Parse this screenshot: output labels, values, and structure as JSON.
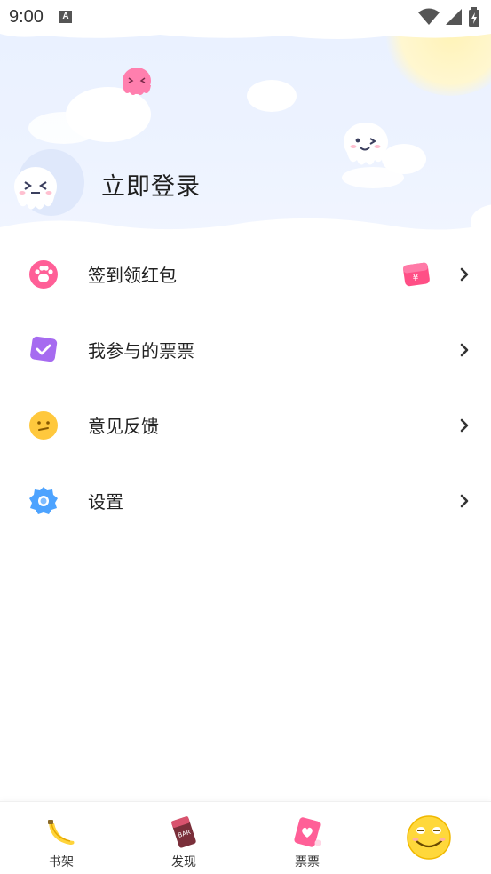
{
  "status_bar": {
    "time": "9:00",
    "notification_glyph": "A",
    "icons": [
      "wifi-icon",
      "signal-icon",
      "battery-icon"
    ]
  },
  "header": {
    "login_label": "立即登录"
  },
  "menu": {
    "items": [
      {
        "label": "签到领红包",
        "icon": "paw-icon",
        "extra_icon": "red-packet-icon"
      },
      {
        "label": "我参与的票票",
        "icon": "ticket-check-icon"
      },
      {
        "label": "意见反馈",
        "icon": "face-icon"
      },
      {
        "label": "设置",
        "icon": "gear-icon"
      }
    ]
  },
  "redpack": {
    "symbol": "¥"
  },
  "bottom_nav": {
    "items": [
      {
        "label": "书架",
        "icon": "banana-icon"
      },
      {
        "label": "发现",
        "icon": "chocolate-icon"
      },
      {
        "label": "票票",
        "icon": "heart-ticket-icon"
      },
      {
        "label": "",
        "icon": "smiley-avatar-icon"
      }
    ],
    "discover_badge": "BAR"
  },
  "colors": {
    "header_bg": "#eaf1ff",
    "pink": "#ff5f97",
    "purple": "#a66bf0",
    "yellow": "#ffc83d",
    "blue": "#4da3ff"
  }
}
